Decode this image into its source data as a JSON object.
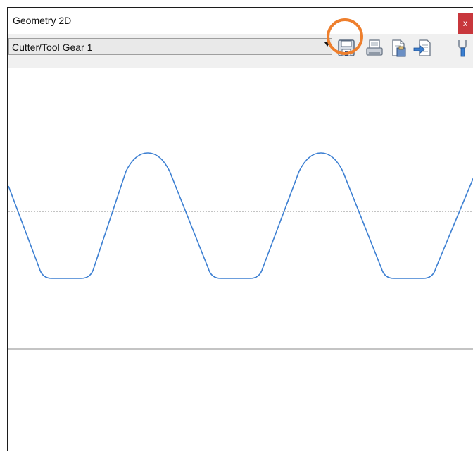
{
  "window": {
    "title": "Geometry 2D",
    "close_label": "x"
  },
  "toolbar": {
    "gear_select": {
      "value": "Cutter/Tool Gear 1"
    },
    "icons": [
      {
        "name": "save-icon"
      },
      {
        "name": "print-icon"
      },
      {
        "name": "clipboard-icon"
      },
      {
        "name": "export-icon"
      },
      {
        "name": "wrench-icon"
      }
    ],
    "highlight_color": "#ee7f2d"
  },
  "plot": {
    "profile_color": "#3c7fd2",
    "reference_line_color": "#8a8a8a",
    "baseline_color": "#8a8a8a"
  }
}
